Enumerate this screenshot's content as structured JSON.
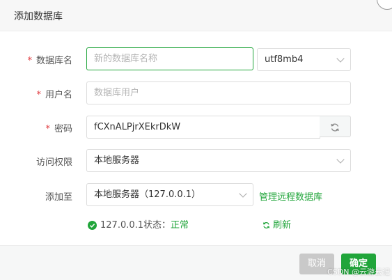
{
  "dialog": {
    "title": "添加数据库"
  },
  "form": {
    "db_name": {
      "label": "数据库名",
      "placeholder": "新的数据库名称",
      "value": ""
    },
    "charset": {
      "value": "utf8mb4"
    },
    "username": {
      "label": "用户名",
      "placeholder": "数据库用户",
      "value": ""
    },
    "password": {
      "label": "密码",
      "value": "fCXnALPjrXEkrDkW"
    },
    "access": {
      "label": "访问权限",
      "value": "本地服务器"
    },
    "add_to": {
      "label": "添加至",
      "value": "本地服务器（127.0.0.1）",
      "manage_link": "管理远程数据库"
    },
    "status": {
      "prefix": "127.0.0.1状态：",
      "value": "正常",
      "refresh": "刷新"
    }
  },
  "footer": {
    "cancel": "取消",
    "confirm": "确定"
  },
  "watermark": "CSDN @云游云记",
  "colors": {
    "accent": "#20a53a",
    "required": "#e0393e"
  }
}
